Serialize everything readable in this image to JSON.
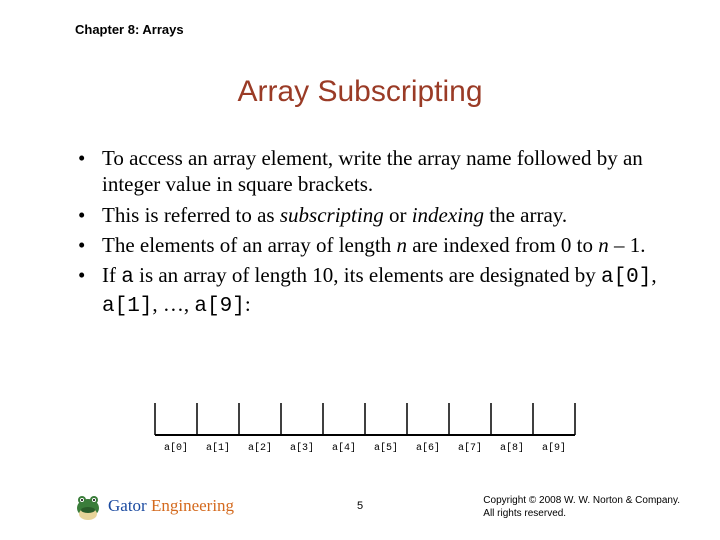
{
  "header": {
    "chapter": "Chapter 8: Arrays"
  },
  "title": "Array Subscripting",
  "bullets": [
    {
      "pre": "To access an array element, write the array name followed by an integer value in square brackets.",
      "em1": "",
      "mid1": "",
      "em2": "",
      "mid2": ""
    },
    {
      "pre": "This is referred to as ",
      "em1": "subscripting",
      "mid1": " or ",
      "em2": "indexing",
      "mid2": " the array."
    },
    {
      "pre": "The elements of an array of length ",
      "em1": "n",
      "mid1": " are indexed from 0 to ",
      "em2": "n",
      "mid2": " – 1."
    },
    {
      "pre": "If ",
      "code1": "a",
      "mid1": " is an array of length 10, its elements are designated by ",
      "code2": "a[0]",
      "mid2": ", ",
      "code3": "a[1]",
      "mid3": ", …, ",
      "code4": "a[9]",
      "tail": ":"
    }
  ],
  "diagram": {
    "labels": [
      "a[0]",
      "a[1]",
      "a[2]",
      "a[3]",
      "a[4]",
      "a[5]",
      "a[6]",
      "a[7]",
      "a[8]",
      "a[9]"
    ]
  },
  "footer": {
    "brand_a": "Gator ",
    "brand_b": "Engineering",
    "page": "5",
    "copyright_a": "Copyright © 2008 W. W. Norton & Company.",
    "copyright_b": "All rights reserved."
  }
}
